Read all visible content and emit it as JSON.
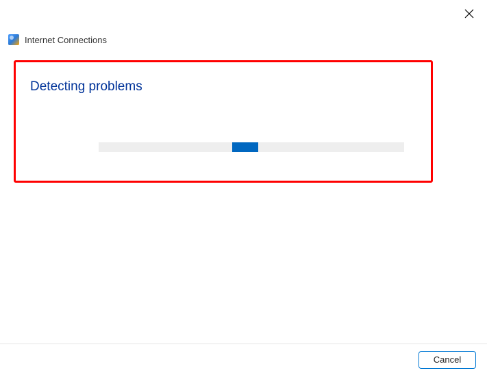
{
  "header": {
    "title": "Internet Connections"
  },
  "status": {
    "heading": "Detecting problems"
  },
  "footer": {
    "cancel_label": "Cancel"
  }
}
